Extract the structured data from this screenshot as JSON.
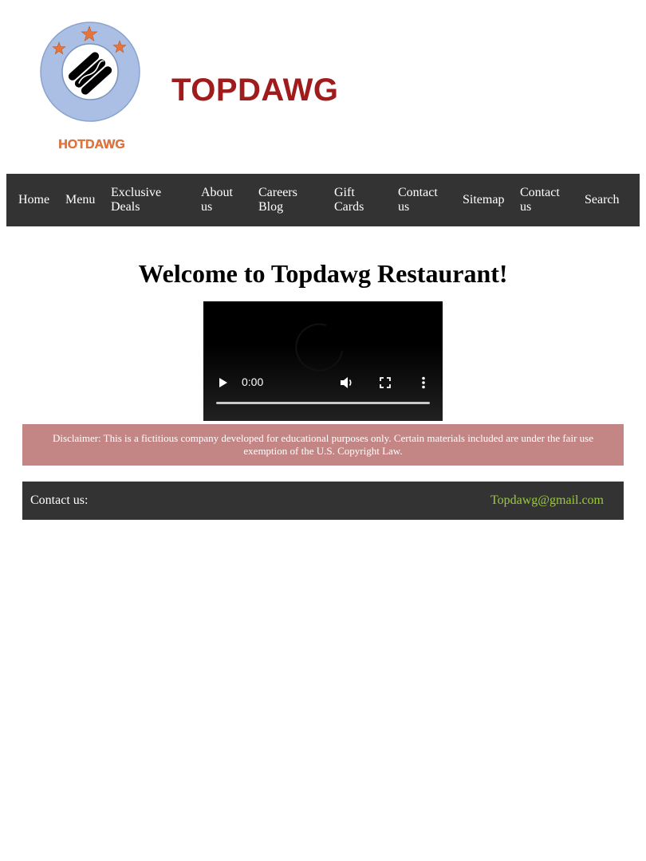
{
  "header": {
    "logo_text": "HOTDAWG",
    "site_title": "TOPDAWG"
  },
  "nav": {
    "items": [
      {
        "label": "Home"
      },
      {
        "label": "Menu"
      },
      {
        "label": "Exclusive Deals",
        "lines": [
          "Exclusive",
          "Deals"
        ]
      },
      {
        "label": "About us",
        "lines": [
          "About",
          "us"
        ]
      },
      {
        "label": "Careers Blog",
        "lines": [
          "Careers",
          "Blog"
        ]
      },
      {
        "label": "Gift Cards",
        "lines": [
          "Gift",
          "Cards"
        ]
      },
      {
        "label": "Contact us",
        "lines": [
          "Contact",
          "us"
        ]
      },
      {
        "label": "Sitemap"
      },
      {
        "label": "Contact us",
        "lines": [
          "Contact",
          "us"
        ]
      },
      {
        "label": "Search"
      }
    ]
  },
  "main": {
    "heading": "Welcome to Topdawg Restaurant!",
    "video": {
      "time": "0:00",
      "progress": 0
    },
    "disclaimer": "Disclaimer: This is a fictitious company developed for educational purposes only. Certain materials included are under the fair use exemption of the U.S. Copyright Law."
  },
  "footer": {
    "contact_label": "Contact us:",
    "email": "Topdawg@gmail.com"
  },
  "colors": {
    "title": "#a01c1c",
    "nav_bg": "#333333",
    "disclaimer_bg": "#c48585",
    "email": "#9acd32",
    "logo_ring": "#aabfe3",
    "logo_star": "#e8743b"
  },
  "icons": [
    "hotdog-icon",
    "star-icon",
    "play-icon",
    "volume-icon",
    "fullscreen-icon",
    "more-options-icon",
    "loading-spinner-icon"
  ]
}
